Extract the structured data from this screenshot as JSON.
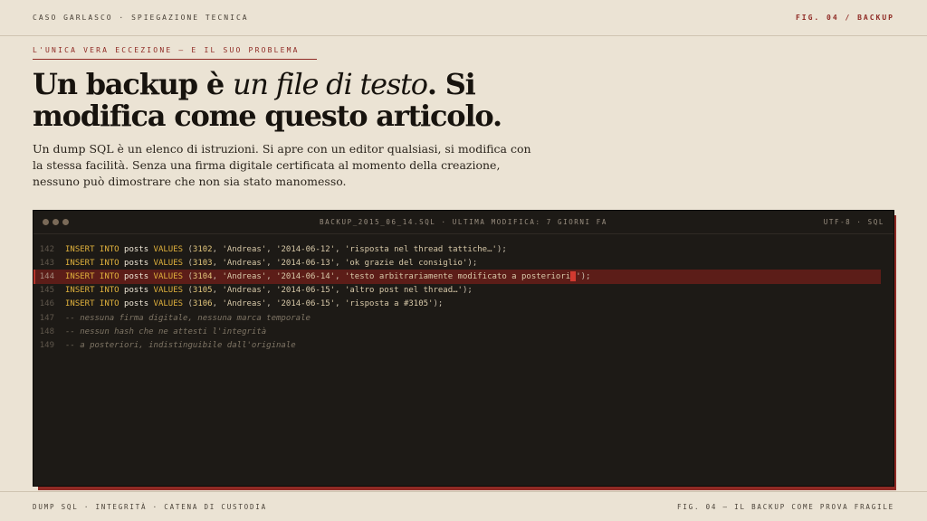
{
  "header": {
    "left": "CASO GARLASCO · SPIEGAZIONE TECNICA",
    "right": "FIG. 04 / BACKUP"
  },
  "kicker": "L'UNICA VERA ECCEZIONE — E IL SUO PROBLEMA",
  "headline": {
    "part1": "Un backup è ",
    "emphasis": "un file di testo",
    "part2": ". Si modifica come questo articolo."
  },
  "lede": "Un dump SQL è un elenco di istruzioni. Si apre con un editor qualsiasi, si modifica con la stessa facilità. Senza una firma digitale certificata al momento della creazione, nessuno può dimostrare che non sia stato manomesso.",
  "editor": {
    "title": "BACKUP_2015_06_14.SQL · ULTIMA MODIFICA: 7 GIORNI FA",
    "encoding": "UTF-8 · SQL",
    "lines": [
      {
        "n": "142",
        "id": "3102",
        "date": "'2014-06-12'",
        "text": "'risposta nel thread tattiche…'"
      },
      {
        "n": "143",
        "id": "3103",
        "date": "'2014-06-13'",
        "text": "'ok grazie del consiglio'"
      },
      {
        "n": "144",
        "id": "3104",
        "date": "'2014-06-14'",
        "text": "'testo arbitrariamente modificato a posteriori"
      },
      {
        "n": "145",
        "id": "3105",
        "date": "'2014-06-15'",
        "text": "'altro post nel thread…'"
      },
      {
        "n": "146",
        "id": "3106",
        "date": "'2014-06-15'",
        "text": "'risposta a #3105'"
      }
    ],
    "sql_insert": "INSERT INTO",
    "sql_table": "posts",
    "sql_values": "VALUES",
    "author": "'Andreas'",
    "cursor_tail": "');",
    "comments": [
      {
        "n": "147",
        "text": "-- nessuna firma digitale, nessuna marca temporale"
      },
      {
        "n": "148",
        "text": "-- nessun hash che ne attesti l'integrità"
      },
      {
        "n": "149",
        "text": "-- a posteriori, indistinguibile dall'originale"
      }
    ],
    "accent_color": "#8f2a24",
    "highlight_color": "#5c1d18"
  },
  "footer": {
    "left": "DUMP SQL · INTEGRITÀ · CATENA DI CUSTODIA",
    "right": "FIG. 04 — IL BACKUP COME PROVA FRAGILE"
  }
}
